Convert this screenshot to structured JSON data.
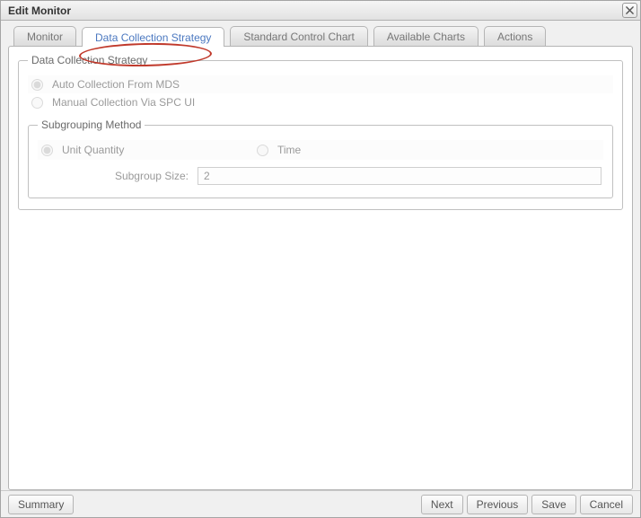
{
  "window": {
    "title": "Edit Monitor"
  },
  "tabs": {
    "monitor": "Monitor",
    "strategy": "Data Collection Strategy",
    "standard_chart": "Standard Control Chart",
    "available_charts": "Available Charts",
    "actions": "Actions"
  },
  "strategy": {
    "legend": "Data Collection Strategy",
    "auto_label": "Auto Collection From MDS",
    "manual_label": "Manual Collection Via SPC UI",
    "subgrouping": {
      "legend": "Subgrouping Method",
      "unit_label": "Unit Quantity",
      "time_label": "Time",
      "size_label": "Subgroup Size:",
      "size_value": "2"
    }
  },
  "footer": {
    "summary": "Summary",
    "next": "Next",
    "previous": "Previous",
    "save": "Save",
    "cancel": "Cancel"
  }
}
